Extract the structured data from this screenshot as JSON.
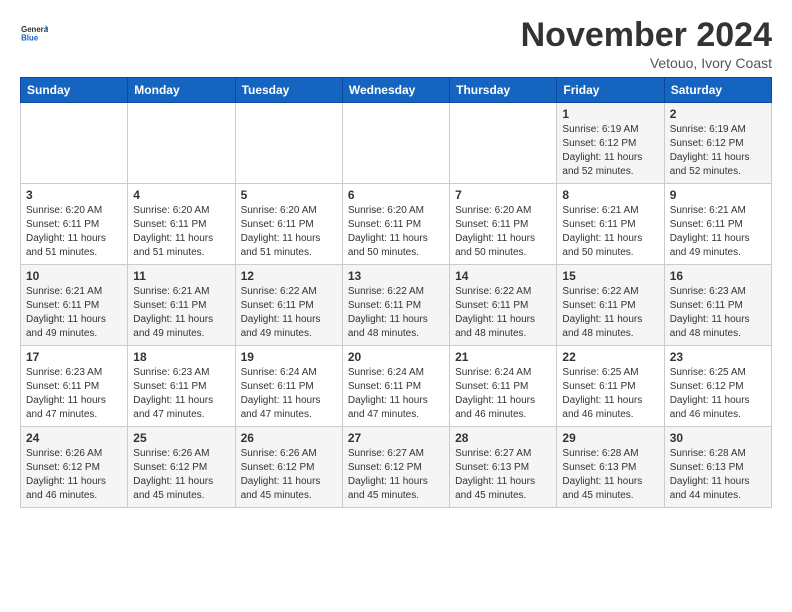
{
  "logo": {
    "line1": "General",
    "line2": "Blue"
  },
  "title": "November 2024",
  "location": "Vetouo, Ivory Coast",
  "weekdays": [
    "Sunday",
    "Monday",
    "Tuesday",
    "Wednesday",
    "Thursday",
    "Friday",
    "Saturday"
  ],
  "weeks": [
    [
      {
        "day": "",
        "info": ""
      },
      {
        "day": "",
        "info": ""
      },
      {
        "day": "",
        "info": ""
      },
      {
        "day": "",
        "info": ""
      },
      {
        "day": "",
        "info": ""
      },
      {
        "day": "1",
        "info": "Sunrise: 6:19 AM\nSunset: 6:12 PM\nDaylight: 11 hours\nand 52 minutes."
      },
      {
        "day": "2",
        "info": "Sunrise: 6:19 AM\nSunset: 6:12 PM\nDaylight: 11 hours\nand 52 minutes."
      }
    ],
    [
      {
        "day": "3",
        "info": "Sunrise: 6:20 AM\nSunset: 6:11 PM\nDaylight: 11 hours\nand 51 minutes."
      },
      {
        "day": "4",
        "info": "Sunrise: 6:20 AM\nSunset: 6:11 PM\nDaylight: 11 hours\nand 51 minutes."
      },
      {
        "day": "5",
        "info": "Sunrise: 6:20 AM\nSunset: 6:11 PM\nDaylight: 11 hours\nand 51 minutes."
      },
      {
        "day": "6",
        "info": "Sunrise: 6:20 AM\nSunset: 6:11 PM\nDaylight: 11 hours\nand 50 minutes."
      },
      {
        "day": "7",
        "info": "Sunrise: 6:20 AM\nSunset: 6:11 PM\nDaylight: 11 hours\nand 50 minutes."
      },
      {
        "day": "8",
        "info": "Sunrise: 6:21 AM\nSunset: 6:11 PM\nDaylight: 11 hours\nand 50 minutes."
      },
      {
        "day": "9",
        "info": "Sunrise: 6:21 AM\nSunset: 6:11 PM\nDaylight: 11 hours\nand 49 minutes."
      }
    ],
    [
      {
        "day": "10",
        "info": "Sunrise: 6:21 AM\nSunset: 6:11 PM\nDaylight: 11 hours\nand 49 minutes."
      },
      {
        "day": "11",
        "info": "Sunrise: 6:21 AM\nSunset: 6:11 PM\nDaylight: 11 hours\nand 49 minutes."
      },
      {
        "day": "12",
        "info": "Sunrise: 6:22 AM\nSunset: 6:11 PM\nDaylight: 11 hours\nand 49 minutes."
      },
      {
        "day": "13",
        "info": "Sunrise: 6:22 AM\nSunset: 6:11 PM\nDaylight: 11 hours\nand 48 minutes."
      },
      {
        "day": "14",
        "info": "Sunrise: 6:22 AM\nSunset: 6:11 PM\nDaylight: 11 hours\nand 48 minutes."
      },
      {
        "day": "15",
        "info": "Sunrise: 6:22 AM\nSunset: 6:11 PM\nDaylight: 11 hours\nand 48 minutes."
      },
      {
        "day": "16",
        "info": "Sunrise: 6:23 AM\nSunset: 6:11 PM\nDaylight: 11 hours\nand 48 minutes."
      }
    ],
    [
      {
        "day": "17",
        "info": "Sunrise: 6:23 AM\nSunset: 6:11 PM\nDaylight: 11 hours\nand 47 minutes."
      },
      {
        "day": "18",
        "info": "Sunrise: 6:23 AM\nSunset: 6:11 PM\nDaylight: 11 hours\nand 47 minutes."
      },
      {
        "day": "19",
        "info": "Sunrise: 6:24 AM\nSunset: 6:11 PM\nDaylight: 11 hours\nand 47 minutes."
      },
      {
        "day": "20",
        "info": "Sunrise: 6:24 AM\nSunset: 6:11 PM\nDaylight: 11 hours\nand 47 minutes."
      },
      {
        "day": "21",
        "info": "Sunrise: 6:24 AM\nSunset: 6:11 PM\nDaylight: 11 hours\nand 46 minutes."
      },
      {
        "day": "22",
        "info": "Sunrise: 6:25 AM\nSunset: 6:11 PM\nDaylight: 11 hours\nand 46 minutes."
      },
      {
        "day": "23",
        "info": "Sunrise: 6:25 AM\nSunset: 6:12 PM\nDaylight: 11 hours\nand 46 minutes."
      }
    ],
    [
      {
        "day": "24",
        "info": "Sunrise: 6:26 AM\nSunset: 6:12 PM\nDaylight: 11 hours\nand 46 minutes."
      },
      {
        "day": "25",
        "info": "Sunrise: 6:26 AM\nSunset: 6:12 PM\nDaylight: 11 hours\nand 45 minutes."
      },
      {
        "day": "26",
        "info": "Sunrise: 6:26 AM\nSunset: 6:12 PM\nDaylight: 11 hours\nand 45 minutes."
      },
      {
        "day": "27",
        "info": "Sunrise: 6:27 AM\nSunset: 6:12 PM\nDaylight: 11 hours\nand 45 minutes."
      },
      {
        "day": "28",
        "info": "Sunrise: 6:27 AM\nSunset: 6:13 PM\nDaylight: 11 hours\nand 45 minutes."
      },
      {
        "day": "29",
        "info": "Sunrise: 6:28 AM\nSunset: 6:13 PM\nDaylight: 11 hours\nand 45 minutes."
      },
      {
        "day": "30",
        "info": "Sunrise: 6:28 AM\nSunset: 6:13 PM\nDaylight: 11 hours\nand 44 minutes."
      }
    ]
  ]
}
